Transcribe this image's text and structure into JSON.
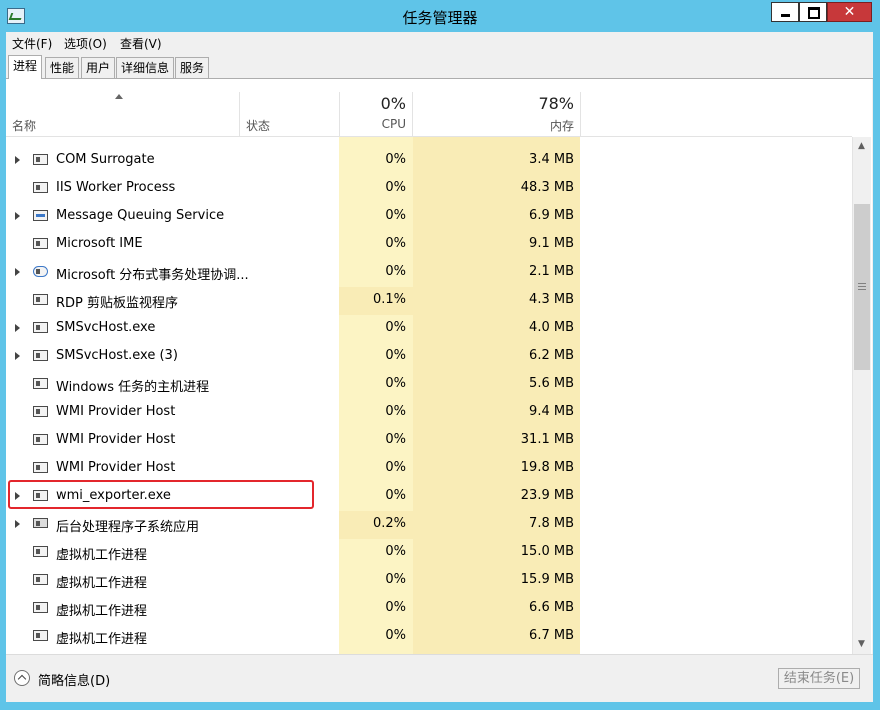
{
  "window": {
    "title": "任务管理器"
  },
  "menu": [
    "文件(F)",
    "选项(O)",
    "查看(V)"
  ],
  "tabs": [
    "进程",
    "性能",
    "用户",
    "详细信息",
    "服务"
  ],
  "header": {
    "name": "名称",
    "status": "状态",
    "cpu_pct": "0%",
    "cpu": "CPU",
    "mem_pct": "78%",
    "mem": "内存"
  },
  "rows": [
    {
      "name": "COM Surrogate",
      "cpu": "0%",
      "mem": "3.4 MB",
      "expandable": true,
      "icon": "app-icon"
    },
    {
      "name": "IIS Worker Process",
      "cpu": "0%",
      "mem": "48.3 MB",
      "expandable": false,
      "icon": "app-icon"
    },
    {
      "name": "Message Queuing Service",
      "cpu": "0%",
      "mem": "6.9 MB",
      "expandable": true,
      "icon": "service-icon"
    },
    {
      "name": "Microsoft IME",
      "cpu": "0%",
      "mem": "9.1 MB",
      "expandable": false,
      "icon": "app-icon"
    },
    {
      "name": "Microsoft 分布式事务处理协调...",
      "cpu": "0%",
      "mem": "2.1 MB",
      "expandable": true,
      "icon": "network-icon"
    },
    {
      "name": "RDP 剪贴板监视程序",
      "cpu": "0.1%",
      "mem": "4.3 MB",
      "expandable": false,
      "icon": "app-icon"
    },
    {
      "name": "SMSvcHost.exe",
      "cpu": "0%",
      "mem": "4.0 MB",
      "expandable": true,
      "icon": "app-icon"
    },
    {
      "name": "SMSvcHost.exe (3)",
      "cpu": "0%",
      "mem": "6.2 MB",
      "expandable": true,
      "icon": "app-icon"
    },
    {
      "name": "Windows 任务的主机进程",
      "cpu": "0%",
      "mem": "5.6 MB",
      "expandable": false,
      "icon": "app-icon"
    },
    {
      "name": "WMI Provider Host",
      "cpu": "0%",
      "mem": "9.4 MB",
      "expandable": false,
      "icon": "wmi-icon"
    },
    {
      "name": "WMI Provider Host",
      "cpu": "0%",
      "mem": "31.1 MB",
      "expandable": false,
      "icon": "wmi-icon"
    },
    {
      "name": "WMI Provider Host",
      "cpu": "0%",
      "mem": "19.8 MB",
      "expandable": false,
      "icon": "wmi-icon"
    },
    {
      "name": "wmi_exporter.exe",
      "cpu": "0%",
      "mem": "23.9 MB",
      "expandable": true,
      "icon": "app-icon"
    },
    {
      "name": "后台处理程序子系统应用",
      "cpu": "0.2%",
      "mem": "7.8 MB",
      "expandable": true,
      "icon": "printer-icon"
    },
    {
      "name": "虚拟机工作进程",
      "cpu": "0%",
      "mem": "15.0 MB",
      "expandable": false,
      "icon": "app-icon"
    },
    {
      "name": "虚拟机工作进程",
      "cpu": "0%",
      "mem": "15.9 MB",
      "expandable": false,
      "icon": "app-icon"
    },
    {
      "name": "虚拟机工作进程",
      "cpu": "0%",
      "mem": "6.6 MB",
      "expandable": false,
      "icon": "app-icon"
    },
    {
      "name": "虚拟机工作进程",
      "cpu": "0%",
      "mem": "6.7 MB",
      "expandable": false,
      "icon": "app-icon"
    }
  ],
  "footer": {
    "fewer_details": "简略信息(D)",
    "end_task": "结束任务(E)"
  },
  "colors": {
    "titlebar": "#5fc4e8",
    "cpu_column": "#fcf4c4",
    "mem_column": "#f9ecb6",
    "highlight": "#e3262c"
  }
}
